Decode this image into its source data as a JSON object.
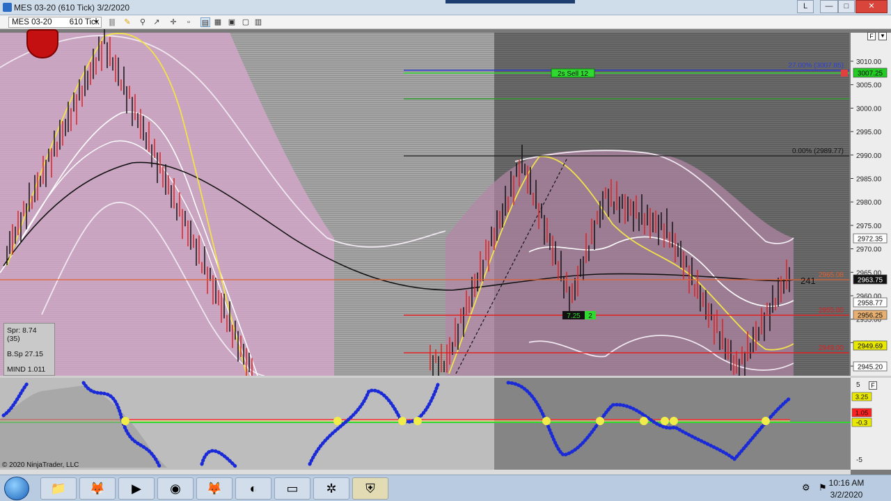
{
  "window": {
    "title": "MES 03-20 (610 Tick)  3/2/2020",
    "btn_l": "L",
    "btn_min": "—",
    "btn_max": "□",
    "btn_close": "✕"
  },
  "toolbar": {
    "instrument": "MES 03-20",
    "interval": "610 Tick"
  },
  "chart": {
    "price_axis_labels": [
      "3010.00",
      "3005.00",
      "3000.00",
      "2995.00",
      "2990.00",
      "2985.00",
      "2980.00",
      "2975.00",
      "2970.00",
      "2965.00",
      "2960.00",
      "2955.00",
      "2950.00",
      "2945.00"
    ],
    "price_tags": [
      {
        "label": "3007.25",
        "color": "#22cc22"
      },
      {
        "label": "2972.35",
        "color": "#ffffff"
      },
      {
        "label": "2963.75",
        "color": "#111111"
      },
      {
        "label": "2958.77",
        "color": "#ffffff"
      },
      {
        "label": "2956.25",
        "color": "#e8b070"
      },
      {
        "label": "2949.69",
        "color": "#e8e800"
      },
      {
        "label": "2945.20",
        "color": "#ffffff"
      }
    ],
    "fib_top": "27.00% (3007.85)",
    "fib_zero": "0.00% (2989.77)",
    "fib_mid": "2965.08",
    "fib_low": "2955.00",
    "fib_lower": "2949.00",
    "order_label": "2s  Sell 12",
    "entry_label": "7.25",
    "entry_qty": "2",
    "bar_counter": "241",
    "info": {
      "spr": "Spr: 8.74 (35)",
      "bsp": "B.Sp 27.15",
      "mind": "MIND 1.011"
    },
    "copyright": "© 2020 NinjaTrader, LLC",
    "osc_axis": [
      "5",
      "0",
      "-5"
    ],
    "osc_tags": [
      {
        "label": "3.25",
        "color": "#e8e800"
      },
      {
        "label": "1.05",
        "color": "#ff2020"
      },
      {
        "label": "-0.3",
        "color": "#e8e800"
      }
    ]
  },
  "taskbar": {
    "time": "10:16 AM",
    "date": "3/2/2020",
    "apps": [
      "explorer-icon",
      "firefox-icon",
      "media-player-icon",
      "chrome-icon",
      "firefox-dev-icon",
      "trading-app-icon",
      "notepad-icon",
      "network-app-icon",
      "ninjatrader-icon"
    ]
  }
}
